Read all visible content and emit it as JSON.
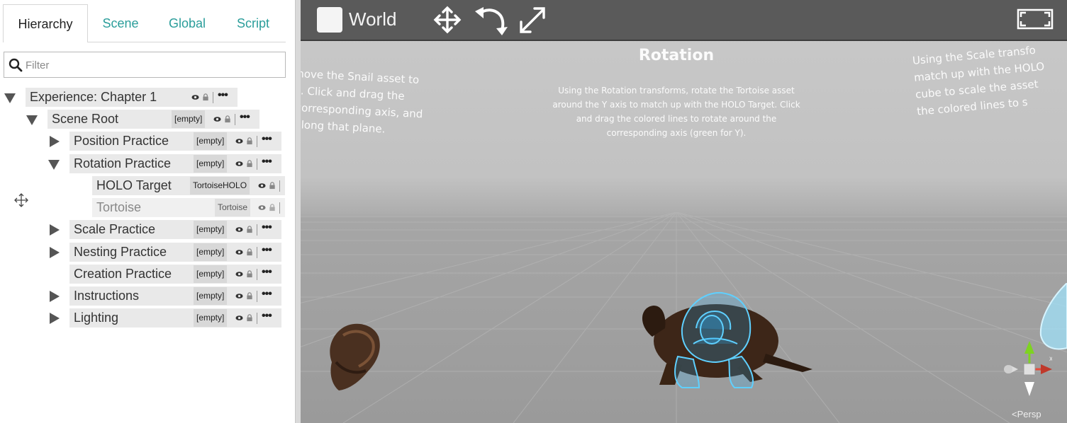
{
  "tabs": [
    {
      "label": "Hierarchy",
      "active": true
    },
    {
      "label": "Scene",
      "active": false
    },
    {
      "label": "Global",
      "active": false
    },
    {
      "label": "Script",
      "active": false
    }
  ],
  "filter": {
    "placeholder": "Filter",
    "value": ""
  },
  "hierarchy": [
    {
      "label": "Experience: Chapter 1",
      "tag": "",
      "expanded": true
    },
    {
      "label": "Scene Root",
      "tag": "[empty]",
      "expanded": true
    },
    {
      "label": "Position Practice",
      "tag": "[empty]",
      "expanded": false
    },
    {
      "label": "Rotation Practice",
      "tag": "[empty]",
      "expanded": true
    },
    {
      "label": "HOLO Target",
      "tag": "TortoiseHOLO"
    },
    {
      "label": "Tortoise",
      "tag": "Tortoise",
      "dimmed": true
    },
    {
      "label": "Scale Practice",
      "tag": "[empty]",
      "expanded": false
    },
    {
      "label": "Nesting Practice",
      "tag": "[empty]",
      "expanded": false
    },
    {
      "label": "Creation Practice",
      "tag": "[empty]"
    },
    {
      "label": "Instructions",
      "tag": "[empty]",
      "expanded": false
    },
    {
      "label": "Lighting",
      "tag": "[empty]",
      "expanded": false
    }
  ],
  "toolbar": {
    "space_label": "World",
    "tools": [
      "move-icon",
      "rotate-icon",
      "scale-icon",
      "maximize-icon"
    ]
  },
  "viewport": {
    "rotation_title": "Rotation",
    "rotation_text": [
      "Using the Rotation transforms, rotate the Tortoise asset",
      "around the Y axis to match up with the HOLO Target. Click",
      "and drag the colored lines to rotate around the",
      "corresponding axis (green for Y)."
    ],
    "left_text": [
      "nove the Snail asset to",
      "t. Click and drag the",
      "corresponding axis, and",
      "along that plane."
    ],
    "right_text": [
      "Using the Scale transfo",
      "match up with the HOLO",
      "cube to scale the asset",
      "the colored lines to s"
    ],
    "camera_label": "<Persp",
    "gizmo_axis_x": "x"
  },
  "colors": {
    "accent": "#2a9d9a",
    "toolbar": "#5a5a5a",
    "holo": "#2fb8ff"
  }
}
